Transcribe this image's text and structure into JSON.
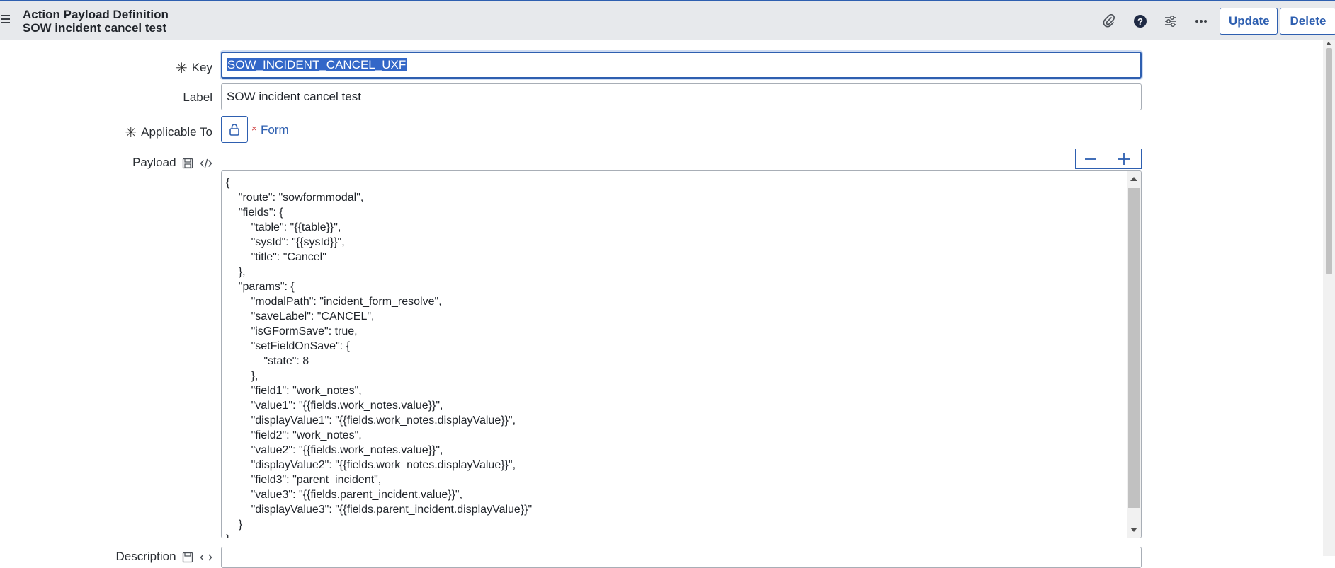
{
  "header": {
    "record_type": "Action Payload Definition",
    "record_name": "SOW incident cancel test",
    "icons": [
      "paperclip-icon",
      "help-icon",
      "settings-sliders-icon",
      "more-icon"
    ],
    "update_label": "Update",
    "delete_label": "Delete"
  },
  "form": {
    "key": {
      "label": "Key",
      "required": true,
      "value": "SOW_INCIDENT_CANCEL_UXF"
    },
    "label_field": {
      "label": "Label",
      "value": "SOW incident cancel test"
    },
    "applicable_to": {
      "label": "Applicable To",
      "required": true,
      "value": "Form",
      "remove_symbol": "×"
    },
    "payload": {
      "label": "Payload",
      "code": "{\n\t\"route\": \"sowformmodal\",\n\t\"fields\": {\n\t\t\"table\": \"{{table}}\",\n\t\t\"sysId\": \"{{sysId}}\",\n\t\t\"title\": \"Cancel\"\n\t},\n\t\"params\": {\n\t\t\"modalPath\": \"incident_form_resolve\",\n\t\t\"saveLabel\": \"CANCEL\",\n\t\t\"isGFormSave\": true,\n\t\t\"setFieldOnSave\": {\n\t\t\t\"state\": 8\n\t\t},\n\t\t\"field1\": \"work_notes\",\n\t\t\"value1\": \"{{fields.work_notes.value}}\",\n\t\t\"displayValue1\": \"{{fields.work_notes.displayValue}}\",\n\t\t\"field2\": \"work_notes\",\n\t\t\"value2\": \"{{fields.work_notes.value}}\",\n\t\t\"displayValue2\": \"{{fields.work_notes.displayValue}}\",\n\t\t\"field3\": \"parent_incident\",\n\t\t\"value3\": \"{{fields.parent_incident.value}}\",\n\t\t\"displayValue3\": \"{{fields.parent_incident.displayValue}}\"\n\t}\n}"
    },
    "description": {
      "label": "Description"
    }
  },
  "colors": {
    "accent": "#2e5fb0",
    "header_bg": "#e7e9ec",
    "selection": "#3367c8"
  }
}
